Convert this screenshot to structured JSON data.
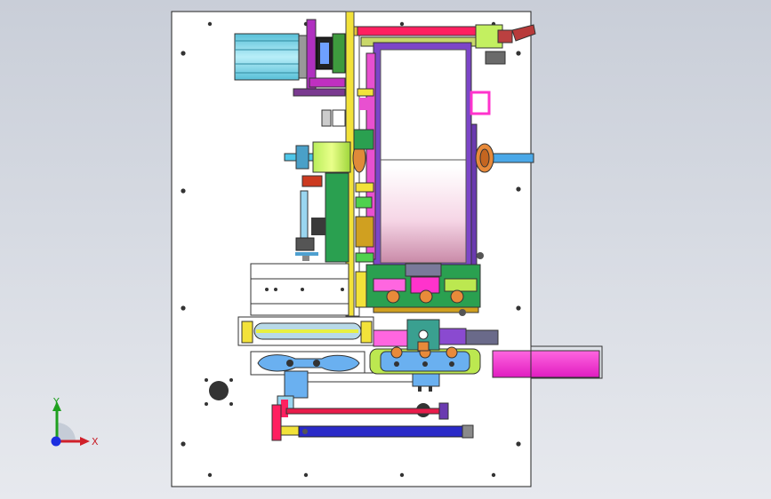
{
  "app": {
    "title": ""
  },
  "triad": {
    "x_label": "X",
    "y_label": "Y"
  },
  "colors": {
    "background_top": "#c9ced8",
    "background_bottom": "#e7e9ee",
    "plate": "#ffffff",
    "accent_magenta": "#ff33cc",
    "accent_blue": "#3a4fd6",
    "accent_green": "#4fd14f",
    "accent_yellow": "#f2e23a",
    "accent_red": "#e81c4b",
    "accent_orange": "#e8a33a",
    "accent_cyan": "#4ec6e8"
  },
  "icons": {
    "triad": "coordinate-triad-icon",
    "x_arrow": "x-axis-arrow-icon",
    "y_arrow": "y-axis-arrow-icon",
    "origin": "origin-sphere-icon"
  }
}
